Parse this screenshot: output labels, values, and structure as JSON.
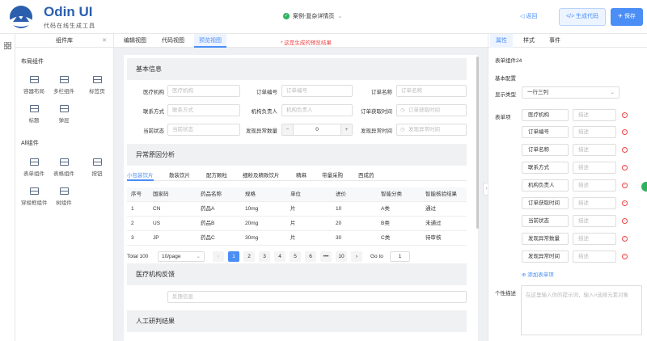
{
  "header": {
    "logo_title": "Odin UI",
    "logo_subtitle": "代码在线生成工具",
    "case_label": "案例-复杂详情页",
    "back_label": "返回",
    "generate_label": "生成代码",
    "save_label": "保存"
  },
  "component_panel": {
    "title": "组件库",
    "layout_section": "布局组件",
    "layout_items": [
      "容器布局",
      "多栏组件",
      "标签页",
      "标题",
      "弹层"
    ],
    "all_section": "All组件",
    "all_items": [
      "表单组件",
      "表格组件",
      "按钮",
      "穿梭框组件",
      "树组件"
    ]
  },
  "center": {
    "tabs": [
      "编辑视图",
      "代码视图",
      "预览视图"
    ],
    "active_tab": "预览视图",
    "hint": "* 这是生成的预览结果",
    "basic_info_title": "基本信息",
    "form_rows": [
      [
        {
          "label": "医疗机构",
          "placeholder": "医疗机构"
        },
        {
          "label": "订单编号",
          "placeholder": "订单编号"
        },
        {
          "label": "订单名称",
          "placeholder": "订单名称"
        }
      ],
      [
        {
          "label": "联系方式",
          "placeholder": "联系方式"
        },
        {
          "label": "机构负责人",
          "placeholder": "机构负责人"
        },
        {
          "label": "订单获取时间",
          "placeholder": "订单获取时间"
        }
      ],
      [
        {
          "label": "当前状态",
          "placeholder": "当前状态"
        },
        {
          "label": "发现异常数量",
          "value": "0"
        },
        {
          "label": "发现异常时间",
          "placeholder": "发现异常时间"
        }
      ]
    ],
    "analysis_title": "异常原因分析",
    "sub_tabs": [
      "小包装饮片",
      "散装饮片",
      "配方颗粒",
      "细粉及精致饮片",
      "精麻",
      "带量采购",
      "西成药"
    ],
    "table_headers": [
      "序号",
      "国家码",
      "药品名称",
      "规格",
      "单位",
      "进价",
      "智能分类",
      "智能核验结果"
    ],
    "table_rows": [
      [
        "1",
        "CN",
        "药品A",
        "10mg",
        "片",
        "10",
        "A类",
        "通过"
      ],
      [
        "2",
        "US",
        "药品B",
        "20mg",
        "片",
        "20",
        "B类",
        "未通过"
      ],
      [
        "3",
        "JP",
        "药品C",
        "30mg",
        "片",
        "30",
        "C类",
        "待审核"
      ]
    ],
    "pagination": {
      "total": "Total 100",
      "page_size": "10/page",
      "pages": [
        "1",
        "2",
        "3",
        "4",
        "5",
        "6",
        "•••",
        "10"
      ],
      "goto_label": "Go to",
      "goto_value": "1"
    },
    "feedback_title": "医疗机构反馈",
    "feedback_placeholder": "反馈信息",
    "manual_title": "人工研判结果"
  },
  "right_panel": {
    "tabs": [
      "属性",
      "样式",
      "事件"
    ],
    "active_tab": "属性",
    "component_name": "表单组件24",
    "basic_config": "基本配置",
    "display_type_label": "显示类型",
    "display_type_value": "一行三列",
    "form_items_label": "表单项",
    "form_items": [
      "医疗机构",
      "订单编号",
      "订单名称",
      "联系方式",
      "机构负责人",
      "订单获取时间",
      "当前状态",
      "发现异常数量",
      "发现异常时间"
    ],
    "desc_placeholder": "描述",
    "add_item_label": "添加表单项",
    "personal_desc_label": "个性描述",
    "textarea_placeholder": "在这里输入你的提示词，输入#选择元素对象"
  }
}
